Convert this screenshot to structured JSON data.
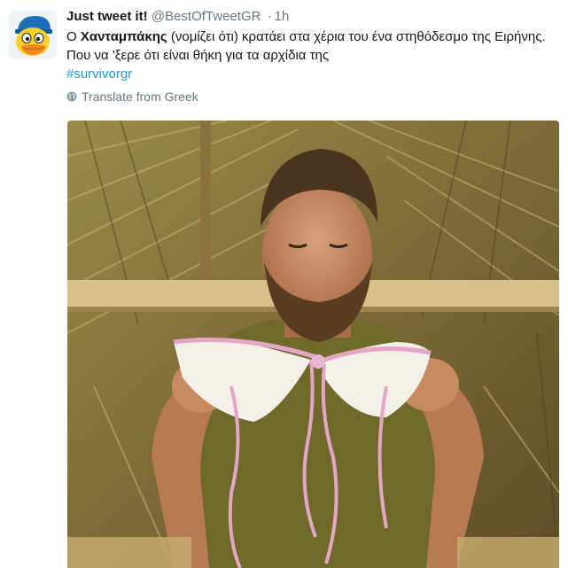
{
  "tweet": {
    "display_name": "Just tweet it!",
    "handle": "@BestOfTweetGR",
    "separator": "·",
    "time": "1h",
    "text_part1": "Ο ",
    "text_bold": "Χανταμπάκης",
    "text_part2": " (νομίζει ότι) κρατάει στα χέρια του ένα στηθόδεσμο της Ειρήνης. Που να 'ξερε ότι είναι θήκη για τα αρχίδια της",
    "hashtag": "#survivorgr",
    "translate_label": "Translate from Greek"
  },
  "icons": {
    "translate": "globe-icon",
    "avatar": "duck-avatar"
  },
  "colors": {
    "link": "#1b95e0",
    "text": "#14171a",
    "secondary": "#657786"
  }
}
